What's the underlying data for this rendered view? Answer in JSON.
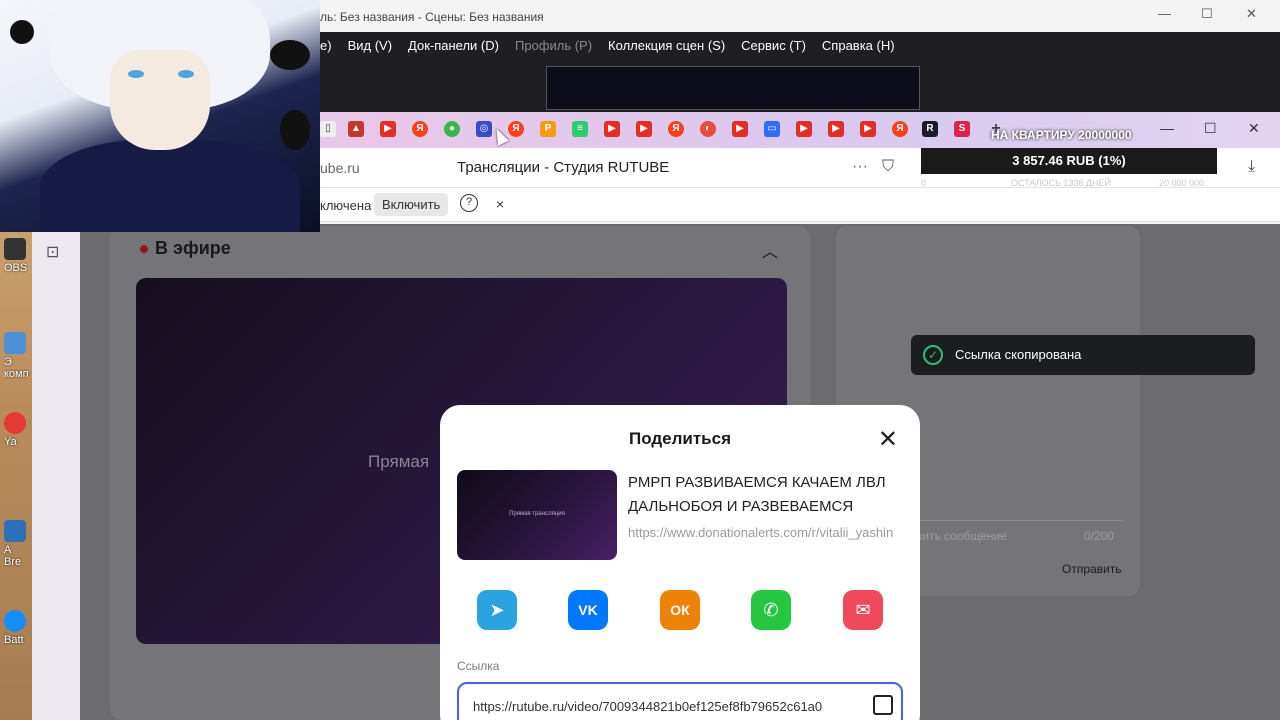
{
  "obs": {
    "title": "ль: Без названия - Сцены: Без названия",
    "menu": [
      {
        "label": "е)",
        "dim": false
      },
      {
        "label": "Вид (V)",
        "dim": false
      },
      {
        "label": "Док-панели (D)",
        "dim": false
      },
      {
        "label": "Профиль (P)",
        "dim": true
      },
      {
        "label": "Коллекция сцен (S)",
        "dim": false
      },
      {
        "label": "Сервис (T)",
        "dim": false
      },
      {
        "label": "Справка (H)",
        "dim": false
      }
    ]
  },
  "browser": {
    "url": "ube.ru",
    "page_title": "Трансляции - Студия RUTUBE",
    "infobar": {
      "status": "ключена",
      "enable_label": "Включить",
      "help": "?",
      "close": "×"
    }
  },
  "desktop": {
    "labels": [
      "OBS",
      "Э\nкомп",
      "Ya",
      "A\nBre",
      "Batt"
    ]
  },
  "donation": {
    "goal_label": "НА КВАРТИРУ 20000000",
    "amount": "3 857.46 RUB (1%)",
    "left_sub": "0",
    "mid_sub": "ОСТАЛОСЬ 1336 ДНЕЙ",
    "right_sub": "20 000 000"
  },
  "studio": {
    "live_label": "В эфире",
    "player_text": "Прямая",
    "message_placeholder": "вить сообщение",
    "message_count": "0/200",
    "send_label": "Отправить"
  },
  "toast": {
    "text": "Ссылка скопирована"
  },
  "share_modal": {
    "title": "Поделиться",
    "thumb_text": "Прямая трансляция",
    "video_title": "РМРП РАЗВИВАЕМСЯ КАЧАЕМ ЛВЛ ДАЛЬНОБОЯ И РАЗВЕВАЕМСЯ",
    "video_desc": "https://www.donationalerts.com/r/vitalii_yashin",
    "targets": [
      {
        "name": "telegram",
        "glyph": "➤",
        "color": "#2aa3de"
      },
      {
        "name": "vk",
        "glyph": "VK",
        "color": "#0077ff"
      },
      {
        "name": "odnoklassniki",
        "glyph": "ОК",
        "color": "#ee8208"
      },
      {
        "name": "whatsapp",
        "glyph": "✆",
        "color": "#25c640"
      },
      {
        "name": "mail",
        "glyph": "✉",
        "color": "#ef4a5b"
      }
    ],
    "link_label": "Ссылка",
    "link_value": "https://rutube.ru/video/7009344821b0ef125ef8fb79652c61a0"
  }
}
